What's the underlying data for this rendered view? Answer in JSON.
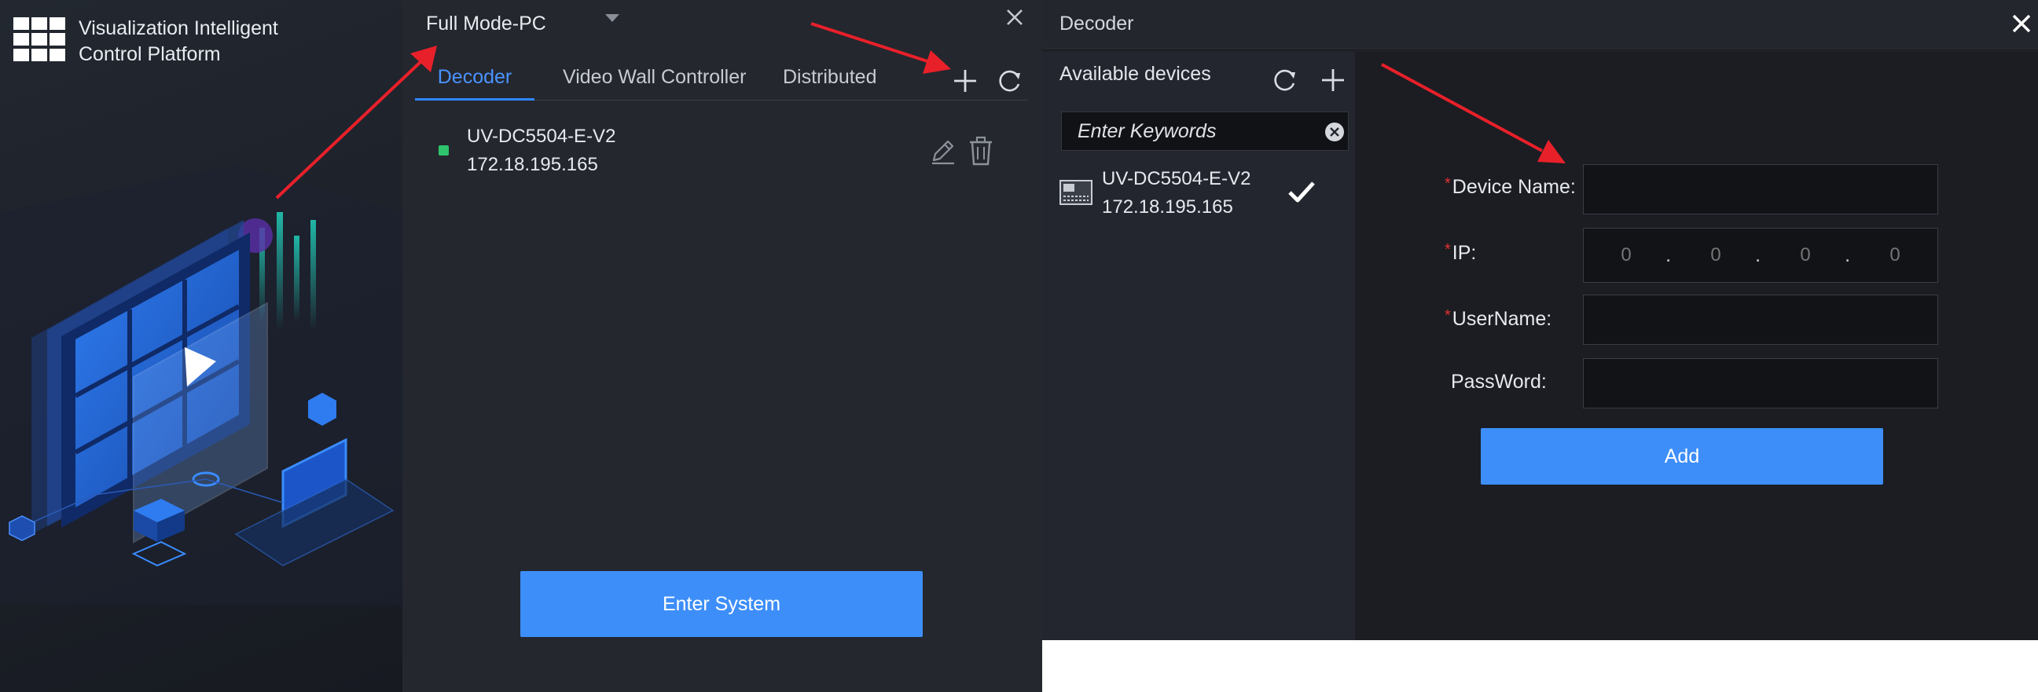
{
  "platform": {
    "title_line1": "Visualization Intelligent",
    "title_line2": "Control Platform"
  },
  "login": {
    "mode": "Full Mode-PC",
    "tabs": [
      {
        "label": "Decoder",
        "active": true
      },
      {
        "label": "Video Wall Controller",
        "active": false
      },
      {
        "label": "Distributed",
        "active": false
      }
    ],
    "device": {
      "name": "UV-DC5504-E-V2",
      "ip": "172.18.195.165",
      "status_color": "#2fc46b"
    },
    "enter_label": "Enter System"
  },
  "dialog": {
    "title": "Decoder",
    "available": {
      "title": "Available devices",
      "search_placeholder": "Enter Keywords",
      "items": [
        {
          "name": "UV-DC5504-E-V2",
          "ip": "172.18.195.165",
          "checked": true
        }
      ]
    },
    "form": {
      "device_name_label": "Device Name:",
      "ip_label": "IP:",
      "username_label": "UserName:",
      "password_label": "PassWord:",
      "required_mark": "*",
      "ip_octets": [
        "0",
        "0",
        "0",
        "0"
      ],
      "ip_separator": ".",
      "add_label": "Add"
    }
  },
  "colors": {
    "accent": "#3d8ef8",
    "active_tab": "#4a93ff",
    "required": "#e03131",
    "annotation_arrow": "#e8202a"
  }
}
